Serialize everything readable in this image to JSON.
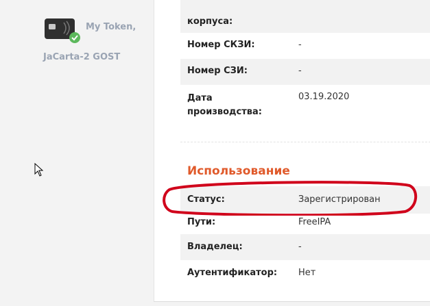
{
  "sidebar": {
    "token_name": "My Token,",
    "token_model": "JaCarta-2 GOST"
  },
  "details": {
    "rows": [
      {
        "label": "корпуса:",
        "value": ""
      },
      {
        "label": "Номер СКЗИ:",
        "value": "-"
      },
      {
        "label": "Номер СЗИ:",
        "value": "-"
      },
      {
        "label": "Дата производства:",
        "value": "03.19.2020"
      }
    ]
  },
  "usage": {
    "title": "Использование",
    "rows": [
      {
        "label": "Статус:",
        "value": "Зарегистрирован"
      },
      {
        "label": "Пути:",
        "value": "FreeIPA"
      },
      {
        "label": "Владелец:",
        "value": "-"
      },
      {
        "label": "Аутентификатор:",
        "value": "Нет"
      }
    ]
  },
  "colors": {
    "section_title": "#e05a2b",
    "highlight_ring": "#d0021b",
    "check_badge": "#5cb85c"
  }
}
